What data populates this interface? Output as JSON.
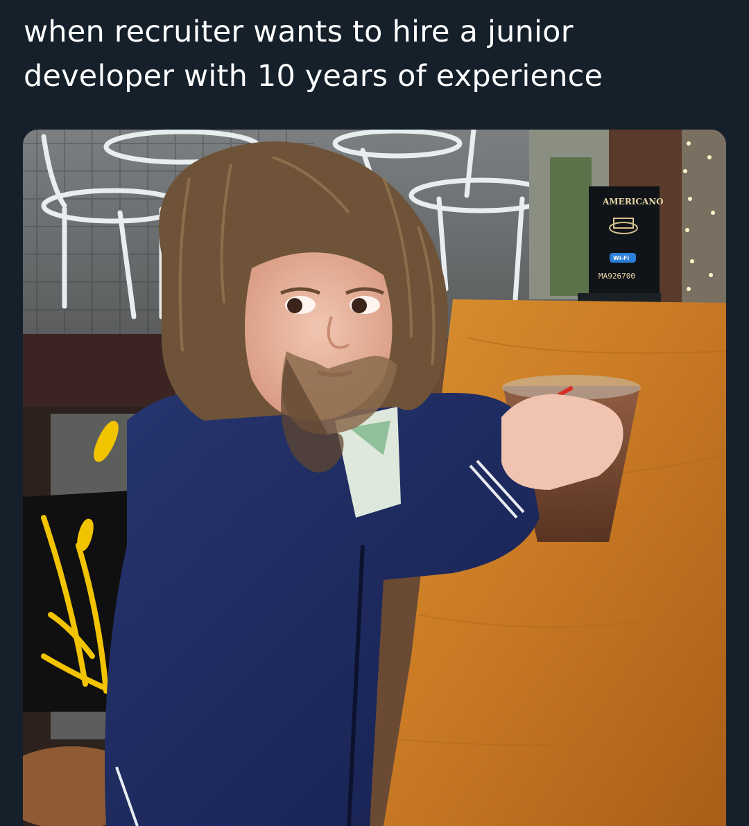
{
  "post": {
    "caption": "when recruiter wants to hire a junior developer with 10 years of experience"
  },
  "photo": {
    "sign": {
      "brand": "AMERICANO",
      "wifi_label": "Wi-Fi",
      "code": "MA926700"
    }
  },
  "colors": {
    "background": "#15202b",
    "caption_text": "#ffffff"
  }
}
